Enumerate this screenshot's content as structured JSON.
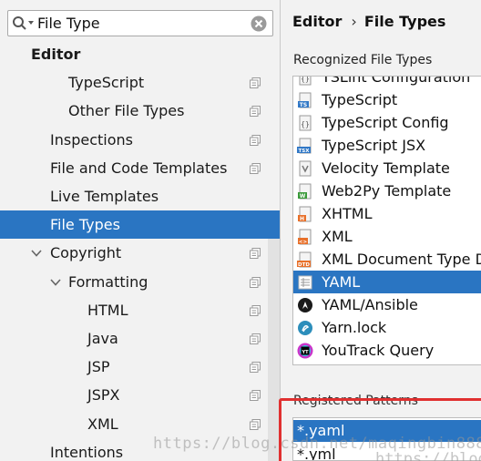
{
  "search": {
    "value": "File Type"
  },
  "tree": [
    {
      "label": "Editor",
      "bold": true,
      "indent": 0,
      "page_icon": false,
      "arrow": ""
    },
    {
      "label": "TypeScript",
      "indent": 2,
      "page_icon": true,
      "arrow": ""
    },
    {
      "label": "Other File Types",
      "indent": 2,
      "page_icon": true,
      "arrow": ""
    },
    {
      "label": "Inspections",
      "indent": 1,
      "page_icon": true,
      "arrow": ""
    },
    {
      "label": "File and Code Templates",
      "indent": 1,
      "page_icon": true,
      "arrow": ""
    },
    {
      "label": "Live Templates",
      "indent": 1,
      "page_icon": false,
      "arrow": ""
    },
    {
      "label": "File Types",
      "indent": 1,
      "page_icon": false,
      "arrow": "",
      "selected": true
    },
    {
      "label": "Copyright",
      "indent": 1,
      "page_icon": true,
      "arrow": "down"
    },
    {
      "label": "Formatting",
      "indent": 2,
      "page_icon": true,
      "arrow": "down"
    },
    {
      "label": "HTML",
      "indent": 3,
      "page_icon": true,
      "arrow": ""
    },
    {
      "label": "Java",
      "indent": 3,
      "page_icon": true,
      "arrow": ""
    },
    {
      "label": "JSP",
      "indent": 3,
      "page_icon": true,
      "arrow": ""
    },
    {
      "label": "JSPX",
      "indent": 3,
      "page_icon": true,
      "arrow": ""
    },
    {
      "label": "XML",
      "indent": 3,
      "page_icon": true,
      "arrow": ""
    },
    {
      "label": "Intentions",
      "indent": 1,
      "page_icon": false,
      "arrow": ""
    }
  ],
  "breadcrumb": {
    "parent": "Editor",
    "separator": "›",
    "current": "File Types"
  },
  "recognized": {
    "label": "Recognized File Types",
    "items": [
      {
        "name": "TSLint Configuration",
        "icon": "tslint-config-icon"
      },
      {
        "name": "TypeScript",
        "icon": "typescript-icon"
      },
      {
        "name": "TypeScript Config",
        "icon": "typescript-config-icon"
      },
      {
        "name": "TypeScript JSX",
        "icon": "tsx-icon"
      },
      {
        "name": "Velocity Template",
        "icon": "velocity-icon"
      },
      {
        "name": "Web2Py Template",
        "icon": "web2py-icon"
      },
      {
        "name": "XHTML",
        "icon": "xhtml-icon"
      },
      {
        "name": "XML",
        "icon": "xml-icon"
      },
      {
        "name": "XML Document Type Definition",
        "icon": "dtd-icon"
      },
      {
        "name": "YAML",
        "icon": "yaml-icon",
        "selected": true
      },
      {
        "name": "YAML/Ansible",
        "icon": "ansible-icon"
      },
      {
        "name": "Yarn.lock",
        "icon": "yarn-icon"
      },
      {
        "name": "YouTrack Query",
        "icon": "youtrack-icon"
      }
    ]
  },
  "patterns": {
    "label": "Registered Patterns",
    "items": [
      {
        "value": "*.yaml",
        "selected": true
      },
      {
        "value": "*.yml"
      }
    ]
  },
  "watermark": {
    "text": "https://blog.csdn.net/maqingbin8888",
    "text2": "https://blog"
  },
  "colors": {
    "selection": "#2a75c2",
    "highlight_box": "#e03030"
  }
}
